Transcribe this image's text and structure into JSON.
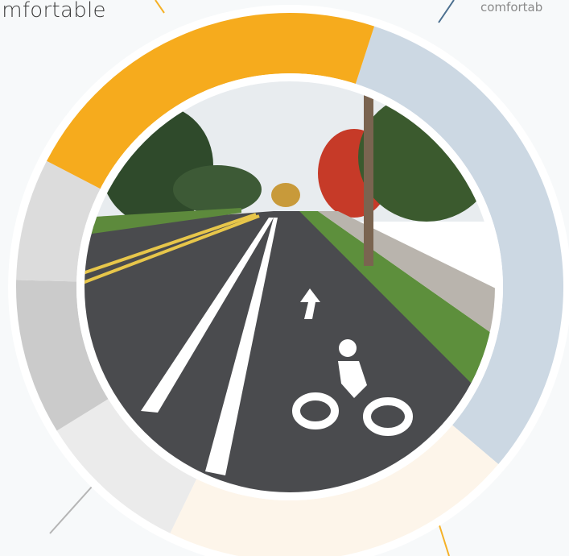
{
  "labels": {
    "top_left": "omfortable",
    "top_right": "comfortab"
  },
  "colors": {
    "background": "#f7f9fa",
    "ring_border": "#ffffff",
    "leader_orange": "#f5b127",
    "leader_blue": "#4b6f8f",
    "leader_gray": "#b5b5b5"
  },
  "photo": {
    "subject": "street with painted bike lane and bicycle symbol",
    "sky": "#e8ecef",
    "road": "#4a4b4e",
    "grass": "#5d8f3c",
    "trees": "#2f4a2b",
    "autumn_tree": "#c63a28",
    "lane_marking": "#ffffff",
    "center_line": "#e7c64a"
  },
  "chart_data": {
    "type": "pie",
    "style": "donut",
    "categories": [
      "",
      "",
      "",
      "",
      "",
      ""
    ],
    "values": [
      31.2,
      21.0,
      9.0,
      9.2,
      7.2,
      22.4
    ],
    "colors": [
      "#ccd8e3",
      "#fdf5ea",
      "#ebebeb",
      "#cbcbcb",
      "#dcdcdc",
      "#f6ab1d"
    ],
    "start_angle_deg": 18,
    "legend": "none"
  }
}
